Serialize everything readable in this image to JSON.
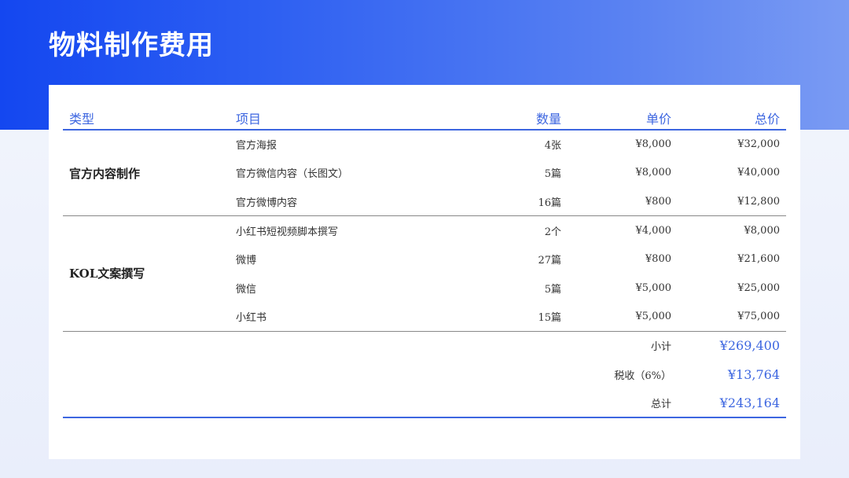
{
  "title": "物料制作费用",
  "headers": {
    "type": "类型",
    "item": "项目",
    "qty": "数量",
    "unit": "单价",
    "total": "总价"
  },
  "groups": [
    {
      "name": "官方内容制作",
      "rows": [
        {
          "item": "官方海报",
          "qty": "4张",
          "unit": "¥8,000",
          "total": "¥32,000"
        },
        {
          "item": "官方微信内容（长图文）",
          "qty": "5篇",
          "unit": "¥8,000",
          "total": "¥40,000"
        },
        {
          "item": "官方微博内容",
          "qty": "16篇",
          "unit": "¥800",
          "total": "¥12,800"
        }
      ]
    },
    {
      "name": "KOL文案撰写",
      "rows": [
        {
          "item": "小红书短视频脚本撰写",
          "qty": "2个",
          "unit": "¥4,000",
          "total": "¥8,000"
        },
        {
          "item": "微博",
          "qty": "27篇",
          "unit": "¥800",
          "total": "¥21,600"
        },
        {
          "item": "微信",
          "qty": "5篇",
          "unit": "¥5,000",
          "total": "¥25,000"
        },
        {
          "item": "小红书",
          "qty": "15篇",
          "unit": "¥5,000",
          "total": "¥75,000"
        }
      ]
    }
  ],
  "summary": {
    "subtotal_label": "小计",
    "subtotal": "¥269,400",
    "tax_label": "税收（6%）",
    "tax": "¥13,764",
    "grand_label": "总计",
    "grand": "¥243,164"
  }
}
